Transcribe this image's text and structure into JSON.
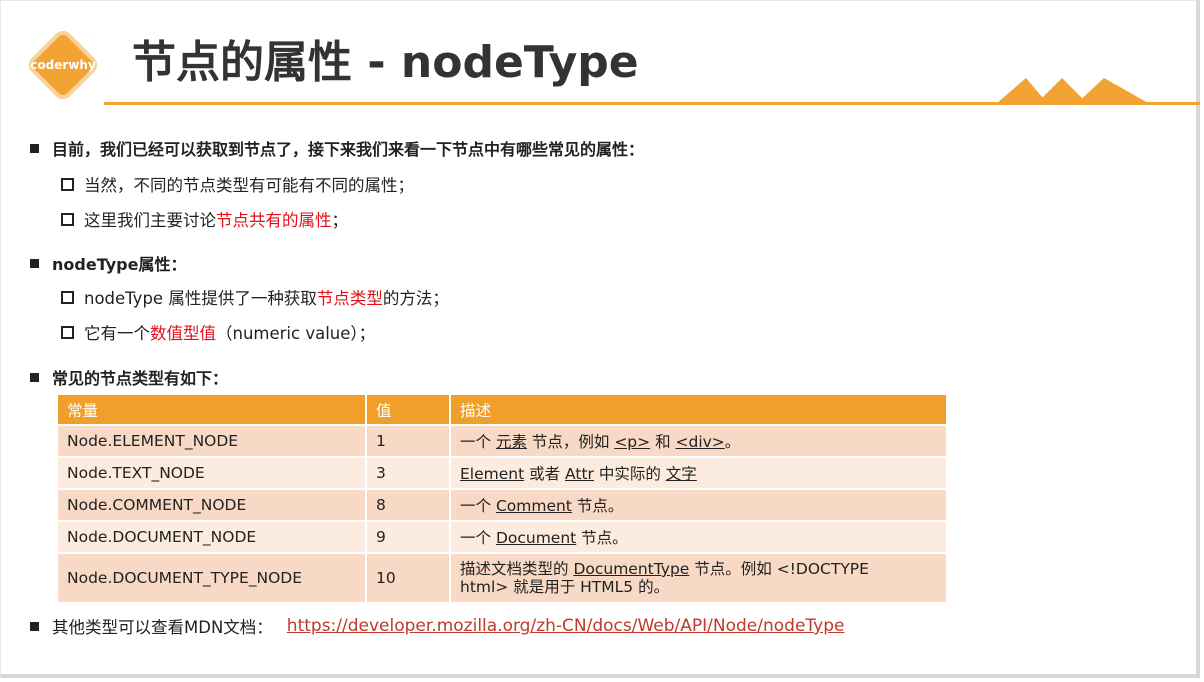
{
  "logo": {
    "text": "coderwhy"
  },
  "title": "节点的属性 - nodeType",
  "colors": {
    "accent": "#f3a333",
    "header_bg": "#f0a02a",
    "highlight": "#e3101a",
    "row_odd": "#f8d9c6",
    "row_even": "#fcecdf"
  },
  "bullets": {
    "b1": "目前，我们已经可以获取到节点了，接下来我们来看一下节点中有哪些常见的属性：",
    "b1_sub1": "当然，不同的节点类型有可能有不同的属性；",
    "b1_sub2_pre": "这里我们主要讨论",
    "b1_sub2_red": "节点共有的属性",
    "b1_sub2_post": "；",
    "b2": "nodeType属性：",
    "b2_sub1_pre": "nodeType 属性提供了一种获取",
    "b2_sub1_red": "节点类型",
    "b2_sub1_post": "的方法；",
    "b2_sub2_pre": "它有一个",
    "b2_sub2_red": "数值型值",
    "b2_sub2_post": "（numeric value）；",
    "b3": "常见的节点类型有如下：",
    "b4": "其他类型可以查看MDN文档：",
    "b4_link": "https://developer.mozilla.org/zh-CN/docs/Web/API/Node/nodeType"
  },
  "table": {
    "headers": [
      "常量",
      "值",
      "描述"
    ],
    "rows": [
      {
        "constant": "Node.ELEMENT_NODE",
        "value": "1",
        "d1": "一个 ",
        "d2": "元素",
        "d3": " 节点，例如 ",
        "d4": "<p>",
        "d5": " 和 ",
        "d6": "<div>",
        "d7": "。"
      },
      {
        "constant": "Node.TEXT_NODE",
        "value": "3",
        "d1": "Element",
        "d2": " 或者 ",
        "d3": "Attr",
        "d4": " 中实际的  ",
        "d5": "文字"
      },
      {
        "constant": "Node.COMMENT_NODE",
        "value": "8",
        "d1": "一个 ",
        "d2": "Comment",
        "d3": " 节点。"
      },
      {
        "constant": "Node.DOCUMENT_NODE",
        "value": "9",
        "d1": "一个 ",
        "d2": "Document",
        "d3": " 节点。"
      },
      {
        "constant": "Node.DOCUMENT_TYPE_NODE",
        "value": "10",
        "d1": "描述文档类型的 ",
        "d2": "DocumentType",
        "d3": " 节点。例如 <!DOCTYPE",
        "d4": "html>  就是用于 HTML5 的。"
      }
    ]
  }
}
